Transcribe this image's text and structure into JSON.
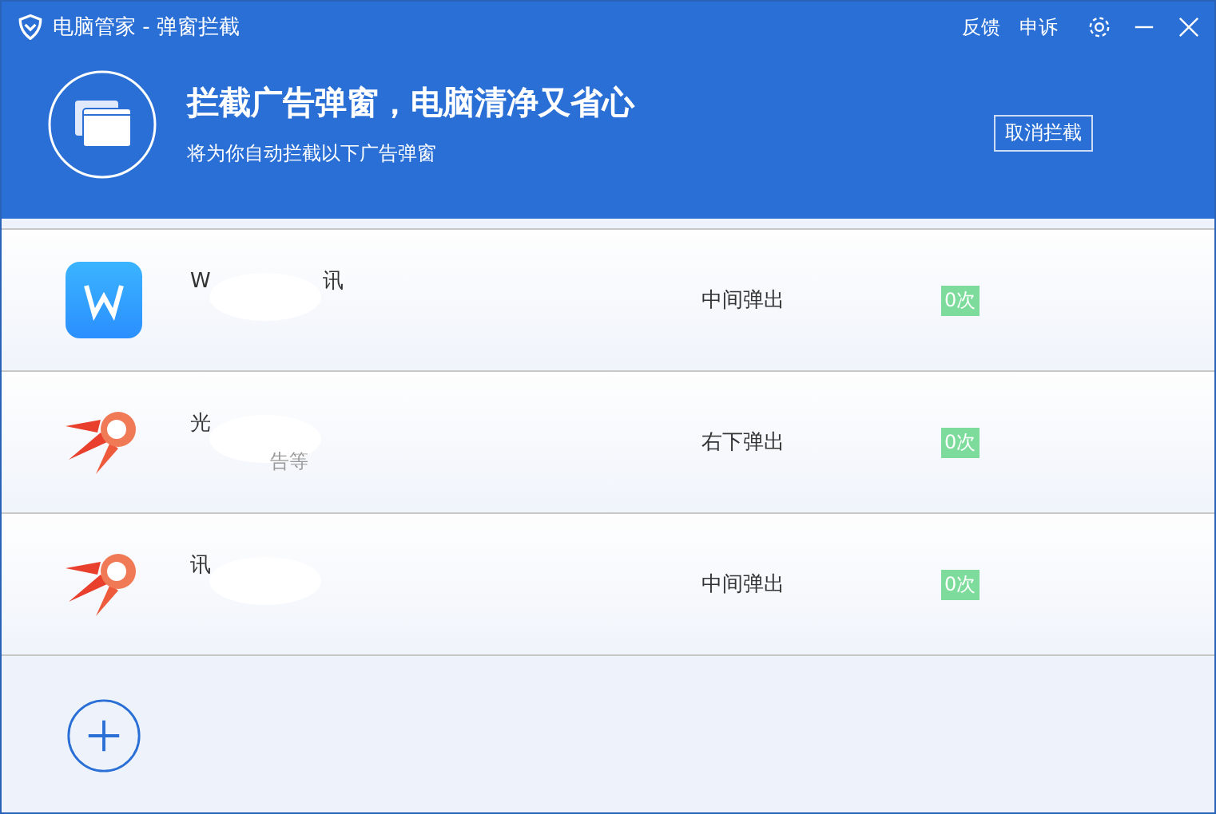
{
  "window": {
    "title": "电脑管家 - 弹窗拦截",
    "actions": [
      "反馈",
      "申诉"
    ]
  },
  "header": {
    "title": "拦截广告弹窗，电脑清净又省心",
    "subtitle": "将为你自动拦截以下广告弹窗",
    "button": "取消拦截"
  },
  "rows": [
    {
      "kind": "w-app",
      "name_parts": [
        "W",
        "讯"
      ],
      "desc_parts": [],
      "position": "中间弹出",
      "count": "0次"
    },
    {
      "kind": "comet",
      "name_parts": [
        "光"
      ],
      "desc_parts": [
        "告等"
      ],
      "position": "右下弹出",
      "count": "0次"
    },
    {
      "kind": "comet",
      "name_parts": [
        "讯"
      ],
      "desc_parts": [],
      "position": "中间弹出",
      "count": "0次"
    }
  ]
}
